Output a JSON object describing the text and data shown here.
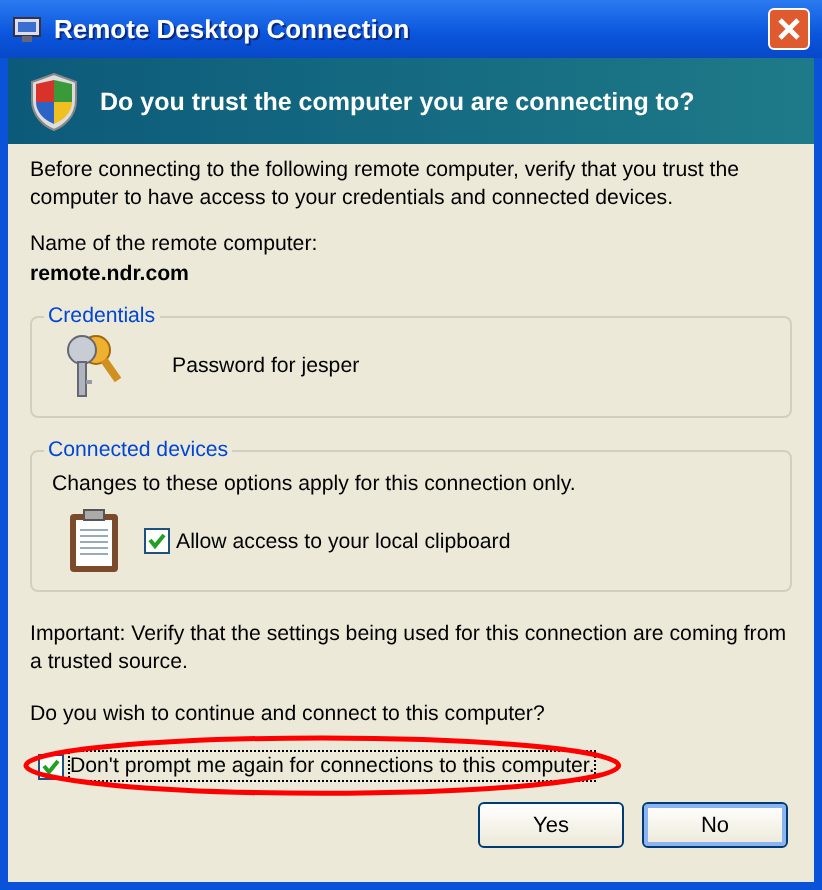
{
  "window": {
    "title": "Remote Desktop Connection"
  },
  "banner": {
    "heading": "Do you trust the computer you are connecting to?"
  },
  "intro": "Before connecting to the following remote computer, verify that you trust the computer to have access to your credentials and connected devices.",
  "computer": {
    "label": "Name of the remote computer:",
    "name": "remote.ndr.com"
  },
  "credentials": {
    "title": "Credentials",
    "text": "Password for jesper"
  },
  "devices": {
    "title": "Connected devices",
    "note": "Changes to these options apply for this connection only.",
    "options": [
      {
        "label": "Allow access to your local clipboard",
        "checked": true
      }
    ]
  },
  "important": "Important: Verify that the settings being used for this connection are coming from a trusted source.",
  "question": "Do you wish to continue and connect to this computer?",
  "dont_prompt": {
    "label": "Don't prompt me again for connections to this computer.",
    "checked": true
  },
  "buttons": [
    {
      "label": "Yes",
      "default": false
    },
    {
      "label": "No",
      "default": true
    }
  ]
}
